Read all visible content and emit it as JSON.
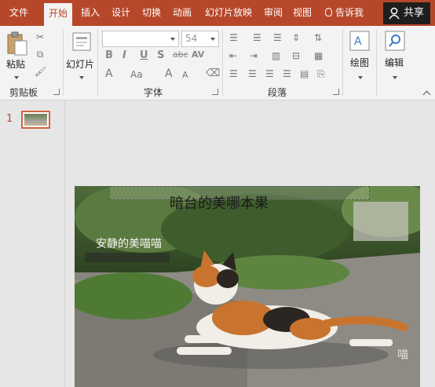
{
  "tabs": [
    {
      "label": "文件"
    },
    {
      "label": "开始"
    },
    {
      "label": "插入"
    },
    {
      "label": "设计"
    },
    {
      "label": "切换"
    },
    {
      "label": "动画"
    },
    {
      "label": "幻灯片放映"
    },
    {
      "label": "审阅"
    },
    {
      "label": "视图"
    }
  ],
  "tellme": "告诉我",
  "share": "共享",
  "ribbon": {
    "paste_label": "粘贴",
    "clipboard_label": "剪贴板",
    "slides_label": "幻灯片",
    "font_group_label": "字体",
    "font_name_value": "",
    "font_size_value": "54",
    "paragraph_label": "段落",
    "drawing_label": "绘图",
    "editing_label": "编辑",
    "format_buttons": [
      "B",
      "I",
      "U",
      "S",
      "abc",
      "AV"
    ],
    "aa_label": "Aa"
  },
  "slide_panel": {
    "slide_number": "1"
  },
  "slide": {
    "title": "暗台的美哪本果",
    "caption": "安静的美喵喵",
    "watermark": "喵"
  },
  "colors": {
    "accent": "#b7472a",
    "ribbon_bg": "#f3f3f3",
    "share_bg": "#1e1e1e",
    "canvas_bg": "#e6e6e6"
  }
}
